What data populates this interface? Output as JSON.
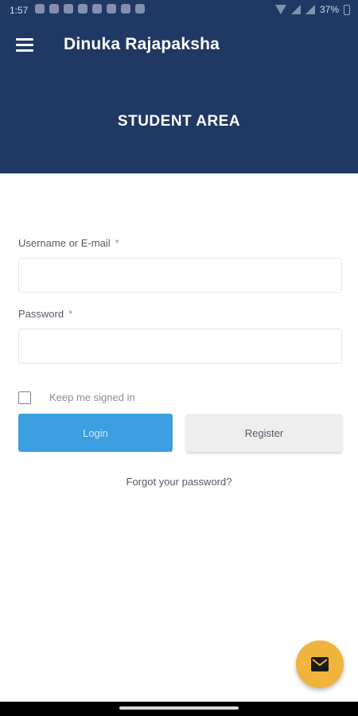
{
  "status_bar": {
    "time": "1:57",
    "battery": "37%"
  },
  "app_bar": {
    "title": "Dinuka Rajapaksha",
    "menu_icon": "hamburger-menu-icon"
  },
  "page": {
    "heading": "STUDENT AREA"
  },
  "form": {
    "username_label": "Username or E-mail",
    "username_required": "*",
    "username_value": "",
    "password_label": "Password",
    "password_required": "*",
    "password_value": "",
    "remember_label": "Keep me signed in",
    "remember_checked": false,
    "login_label": "Login",
    "register_label": "Register",
    "forgot_label": "Forgot your password?"
  },
  "fab": {
    "icon": "mail-icon"
  },
  "colors": {
    "header_bg": "#1f3864",
    "login_button": "#3b9ee0",
    "register_button": "#eeeeef",
    "fab": "#f0b33c"
  }
}
